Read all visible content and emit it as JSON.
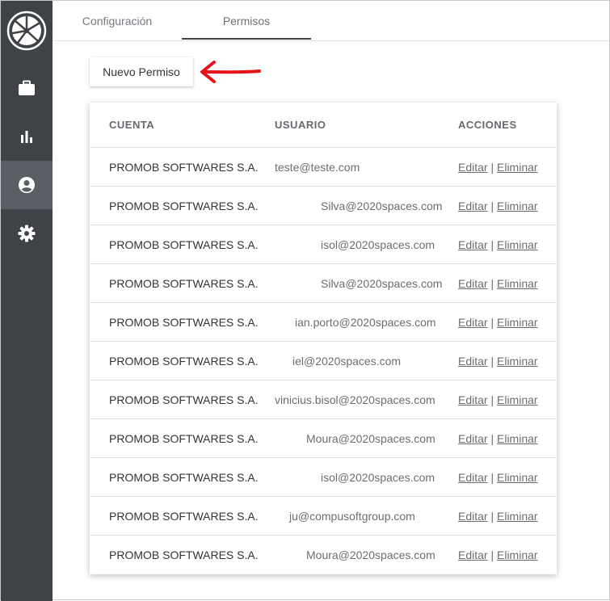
{
  "sidebar": {
    "items": [
      {
        "name": "briefcase-icon"
      },
      {
        "name": "bar-chart-icon"
      },
      {
        "name": "user-circle-icon",
        "active": true
      },
      {
        "name": "gear-icon"
      }
    ]
  },
  "tabs": [
    {
      "label": "Configuración"
    },
    {
      "label": "Permisos",
      "active": true
    }
  ],
  "toolbar": {
    "new_permission_label": "Nuevo Permiso"
  },
  "table": {
    "columns": {
      "account": "CUENTA",
      "user": "USUARIO",
      "actions": "ACCIONES"
    },
    "edit_label": "Editar",
    "separator": "|",
    "delete_label": "Eliminar",
    "rows": [
      {
        "account": "PROMOB SOFTWARES S.A.",
        "user": "teste@teste.com"
      },
      {
        "account": "PROMOB SOFTWARES S.A.",
        "user": "Silva@2020spaces.com"
      },
      {
        "account": "PROMOB SOFTWARES S.A.",
        "user": "isol@2020spaces.com"
      },
      {
        "account": "PROMOB SOFTWARES S.A.",
        "user": "Silva@2020spaces.com"
      },
      {
        "account": "PROMOB SOFTWARES S.A.",
        "user": "ian.porto@2020spaces.com"
      },
      {
        "account": "PROMOB SOFTWARES S.A.",
        "user": "iel@2020spaces.com"
      },
      {
        "account": "PROMOB SOFTWARES S.A.",
        "user": "vinicius.bisol@2020spaces.com"
      },
      {
        "account": "PROMOB SOFTWARES S.A.",
        "user": "Moura@2020spaces.com"
      },
      {
        "account": "PROMOB SOFTWARES S.A.",
        "user": "isol@2020spaces.com"
      },
      {
        "account": "PROMOB SOFTWARES S.A.",
        "user": "ju@compusoftgroup.com"
      },
      {
        "account": "PROMOB SOFTWARES S.A.",
        "user": "Moura@2020spaces.com"
      }
    ]
  },
  "colors": {
    "sidebar": "#3f4347",
    "sidebar_active": "#5a5f65",
    "annotation_arrow": "#e8121b"
  }
}
